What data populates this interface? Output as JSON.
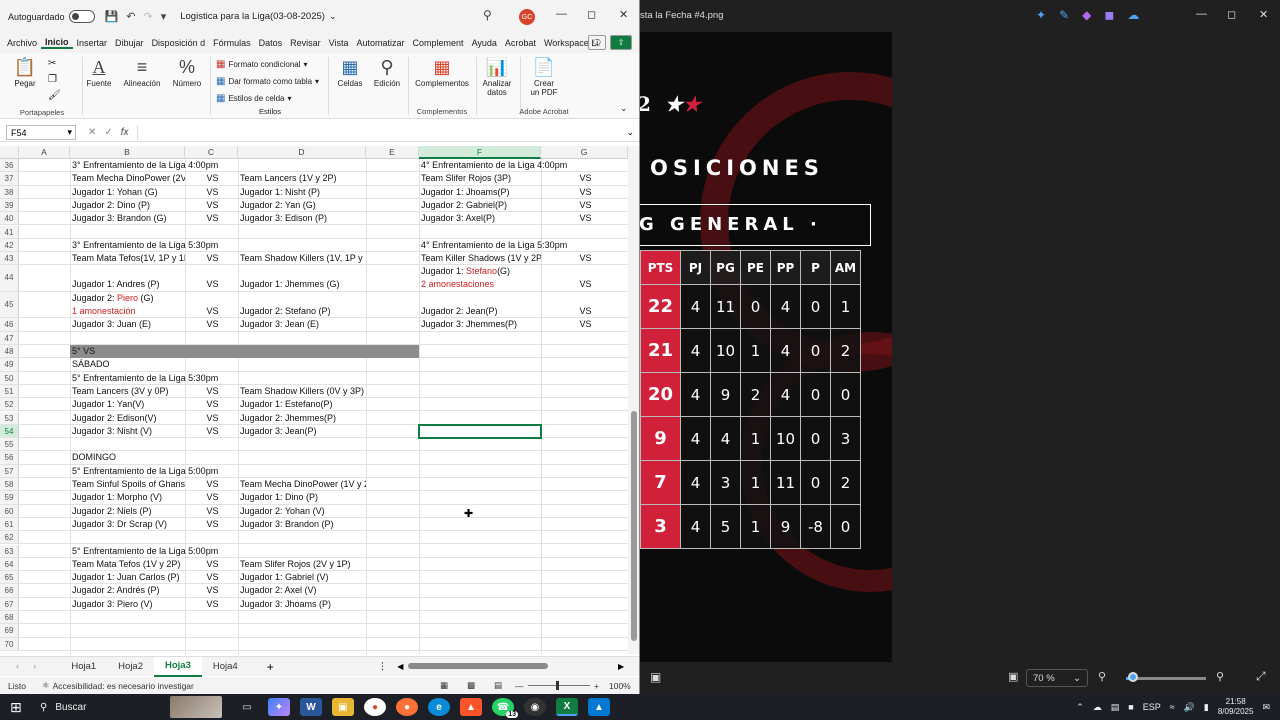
{
  "excel": {
    "autosave_label": "Autoguardado",
    "doc_title": "Logistica para la Liga(03-08-2025)",
    "avatar_initials": "GC",
    "menu": [
      "Archivo",
      "Inicio",
      "Insertar",
      "Dibujar",
      "Disposición d",
      "Fórmulas",
      "Datos",
      "Revisar",
      "Vista",
      "Automatizar",
      "Complement",
      "Ayuda",
      "Acrobat",
      "Workspace Li"
    ],
    "ribbon": {
      "paste": "Pegar",
      "clipboard_group": "Portapapeles",
      "font": "Fuente",
      "alignment": "Alineación",
      "number": "Número",
      "cond_format": "Formato condicional",
      "format_table": "Dar formato como tabla",
      "cell_styles": "Estilos de celda",
      "styles_group": "Estilos",
      "cells": "Celdas",
      "editing": "Edición",
      "addins": "Complementos",
      "addins_group": "Complementos",
      "analyze_l1": "Analizar",
      "analyze_l2": "datos",
      "pdf_l1": "Crear",
      "pdf_l2": "un PDF",
      "acrobat_group": "Adobe Acrobat"
    },
    "namebox": "F54",
    "columns": [
      "A",
      "B",
      "C",
      "D",
      "E",
      "F",
      "G"
    ],
    "rows": [
      {
        "n": "36",
        "B": "3° Enfrentamiento de la Liga 4:00pm",
        "F": "4° Enfrentamiento de la Liga 4:00pm"
      },
      {
        "n": "37",
        "B": "Team Mecha DinoPower (2V",
        "C": "VS",
        "D": "Team Lancers (1V y 2P)",
        "F": "Team Slifer Rojos (3P)",
        "G": "VS"
      },
      {
        "n": "38",
        "B": "Jugador 1: Yohan (G)",
        "C": "VS",
        "D": "Jugador 1: Nisht (P)",
        "F": "Jugador 1:  Jhoams(P)",
        "G": "VS"
      },
      {
        "n": "39",
        "B": "Jugador 2: Dino (P)",
        "C": "VS",
        "D": "Jugador 2: Yan (G)",
        "F": "Jugador 2:  Gabriel(P)",
        "G": "VS"
      },
      {
        "n": "40",
        "B": "Jugador 3: Brandon (G)",
        "C": "VS",
        "D": "Jugador 3: Edison (P)",
        "F": "Jugador 3:  Axel(P)",
        "G": "VS"
      },
      {
        "n": "41"
      },
      {
        "n": "42",
        "B": "3° Enfrentamiento de la Liga 5:30pm",
        "F": "4° Enfrentamiento de la Liga 5:30pm"
      },
      {
        "n": "43",
        "B": "Team Mata Tefos(1V, 1P y 1E",
        "C": "VS",
        "D": "Team Shadow Killers (1V, 1P y 1E)",
        "F": "Team Killer Shadows (1V y 2P",
        "G": "VS"
      },
      {
        "n": "44",
        "B": "Jugador 1: Andres (P)",
        "C": "VS",
        "D": "Jugador 1: Jhemmes (G)",
        "F_pre": "Jugador 1:  ",
        "F_red": "Stefano",
        "F_post": "(G)",
        "F2": "2 amonestaciones",
        "G": "VS",
        "tall": true
      },
      {
        "n": "45",
        "B_pre": "Jugador 2: ",
        "B_red": "Piero",
        "B_post": " (G)",
        "B2": "1 amonestación",
        "C": "VS",
        "D": "Jugador 2: Stefano (P)",
        "F": "Jugador 2:  Jean(P)",
        "G": "VS",
        "tall": true
      },
      {
        "n": "46",
        "B": "Jugador 3: Juan (E)",
        "C": "VS",
        "D": "Jugador 3: Jean (E)",
        "F": "Jugador 3:  Jhemmes(P)",
        "G": "VS"
      },
      {
        "n": "47"
      },
      {
        "n": "48",
        "B": "5° VS",
        "band": true
      },
      {
        "n": "49",
        "B": "SÁBADO"
      },
      {
        "n": "50",
        "B": "5° Enfrentamiento de la Liga 5:30pm"
      },
      {
        "n": "51",
        "B": "Team Lancers (3V y 0P)",
        "C": "VS",
        "D": "Team Shadow Killers (0V y 3P)"
      },
      {
        "n": "52",
        "B": "Jugador 1: Yan(V)",
        "C": "VS",
        "D": "Jugador 1: Estefano(P)"
      },
      {
        "n": "53",
        "B": "Jugador 2: Edison(V)",
        "C": "VS",
        "D": "Jugador 2: Jhemmes(P)"
      },
      {
        "n": "54",
        "B": "Jugador 3: Nisht (V)",
        "C": "VS",
        "D": "Jugador 3: Jean(P)",
        "selected": true
      },
      {
        "n": "55"
      },
      {
        "n": "56",
        "B": "DOMINGO"
      },
      {
        "n": "57",
        "B": "5° Enfrentamiento de la Liga 5:00pm"
      },
      {
        "n": "58",
        "B": "Team Sinful Spoils of Ghans",
        "C": "VS",
        "D": "Team Mecha DinoPower (1V y 2P)"
      },
      {
        "n": "59",
        "B": "Jugador 1: Morpho (V)",
        "C": "VS",
        "D": "Jugador 1: Dino (P)"
      },
      {
        "n": "60",
        "B": "Jugador 2: Niels (P)",
        "C": "VS",
        "D": "Jugador 2: Yohan (V)"
      },
      {
        "n": "61",
        "B": "Jugador 3: Dr Scrap (V)",
        "C": "VS",
        "D": "Jugador 3: Brandon (P)"
      },
      {
        "n": "62"
      },
      {
        "n": "63",
        "B": "5° Enfrentamiento de la Liga 5:00pm"
      },
      {
        "n": "64",
        "B": "Team Mata Tefos (1V y 2P)",
        "C": "VS",
        "D": "Team Slifer Rojos (2V y 1P)"
      },
      {
        "n": "65",
        "B": "Jugador 1: Juan Carlos (P)",
        "C": "VS",
        "D": "Jugador 1: Gabriel (V)"
      },
      {
        "n": "66",
        "B": "Jugador 2: Andrés (P)",
        "C": "VS",
        "D": "Jugador 2: Axel (V)"
      },
      {
        "n": "67",
        "B": "Jugador 3: Piero (V)",
        "C": "VS",
        "D": "Jugador 3: Jhoams (P)"
      },
      {
        "n": "68"
      },
      {
        "n": "69"
      },
      {
        "n": "70"
      }
    ],
    "sheets": [
      "Hoja1",
      "Hoja2",
      "Hoja3",
      "Hoja4"
    ],
    "active_sheet": "Hoja3",
    "status_ready": "Listo",
    "status_accessibility": "Accesibilidad: es necesario investigar",
    "zoom": "100%"
  },
  "viewer": {
    "title": "sta la Fecha #4.png",
    "poster_title": "OSICIONES",
    "general_label": "G GENERAL  ·",
    "logo_prefix": "2",
    "headers": [
      "PTS",
      "PJ",
      "PG",
      "PE",
      "PP",
      "P",
      "AM"
    ],
    "standings": [
      [
        "22",
        "4",
        "11",
        "0",
        "4",
        "0",
        "1"
      ],
      [
        "21",
        "4",
        "10",
        "1",
        "4",
        "0",
        "2"
      ],
      [
        "20",
        "4",
        "9",
        "2",
        "4",
        "0",
        "0"
      ],
      [
        "9",
        "4",
        "4",
        "1",
        "10",
        "0",
        "3"
      ],
      [
        "7",
        "4",
        "3",
        "1",
        "11",
        "0",
        "2"
      ],
      [
        "3",
        "4",
        "5",
        "1",
        "9",
        "-8",
        "0"
      ]
    ],
    "zoom": "70 %"
  },
  "taskbar": {
    "search": "Buscar",
    "lang": "ESP",
    "time": "21:58",
    "date": "8/09/2025",
    "whatsapp_badge": "13"
  }
}
